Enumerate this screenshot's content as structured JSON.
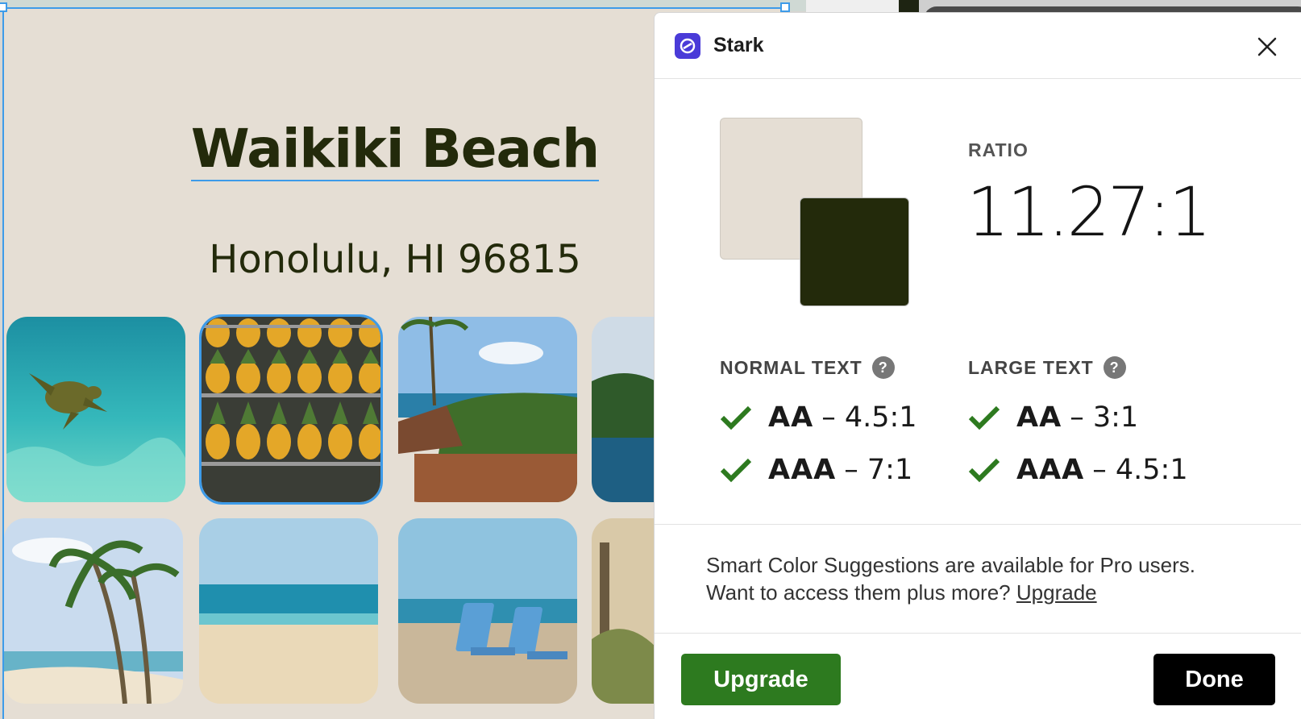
{
  "design": {
    "title": "Waikiki Beach",
    "subtitle": "Honolulu, HI 96815",
    "photos": [
      {
        "name": "sea-turtle-photo"
      },
      {
        "name": "pineapples-photo"
      },
      {
        "name": "coastal-deck-photo"
      },
      {
        "name": "palm-wave-photo"
      },
      {
        "name": "palm-trees-photo"
      },
      {
        "name": "ocean-horizon-photo"
      },
      {
        "name": "beach-chairs-photo"
      },
      {
        "name": "dune-path-photo"
      }
    ],
    "colors": {
      "background": "#e5ded4",
      "text": "#232a0b",
      "selection": "#3d9be9"
    }
  },
  "stark": {
    "title": "Stark",
    "ratio_label": "RATIO",
    "ratio_value": "11.27:1",
    "swatches": {
      "background": "#e5ded4",
      "foreground": "#232a0b"
    },
    "normal_text": {
      "label": "NORMAL TEXT",
      "rows": [
        {
          "level": "AA",
          "rest": "– 4.5:1",
          "pass": true
        },
        {
          "level": "AAA",
          "rest": "– 7:1",
          "pass": true
        }
      ]
    },
    "large_text": {
      "label": "LARGE TEXT",
      "rows": [
        {
          "level": "AA",
          "rest": "– 3:1",
          "pass": true
        },
        {
          "level": "AAA",
          "rest": "– 4.5:1",
          "pass": true
        }
      ]
    },
    "help_glyph": "?",
    "promo_line1": "Smart Color Suggestions are available for Pro users.",
    "promo_line2": "Want to access them plus more?",
    "promo_link": "Upgrade",
    "upgrade_button": "Upgrade",
    "done_button": "Done",
    "colors": {
      "brand": "#4a3bd8",
      "pass": "#2d7a1f",
      "upgrade": "#2d7a1f",
      "done": "#000000"
    }
  }
}
